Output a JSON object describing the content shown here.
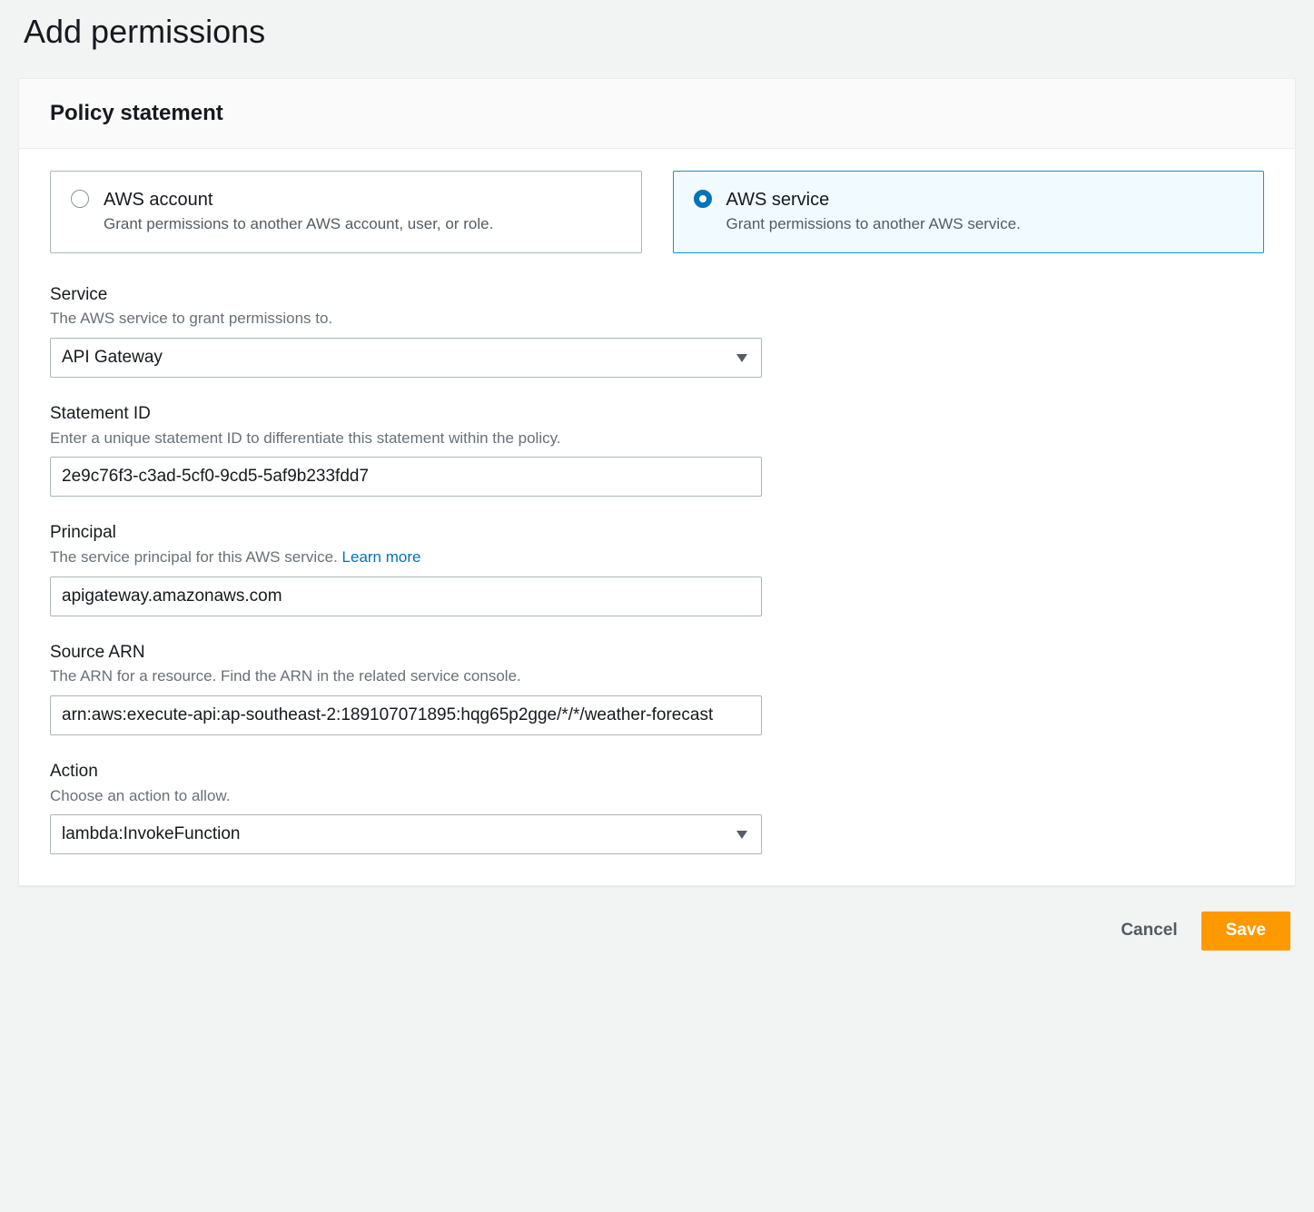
{
  "page": {
    "title": "Add permissions"
  },
  "panel": {
    "header": "Policy statement"
  },
  "radio": {
    "account": {
      "title": "AWS account",
      "desc": "Grant permissions to another AWS account, user, or role."
    },
    "service": {
      "title": "AWS service",
      "desc": "Grant permissions to another AWS service."
    }
  },
  "fields": {
    "service": {
      "label": "Service",
      "hint": "The AWS service to grant permissions to.",
      "value": "API Gateway"
    },
    "statement_id": {
      "label": "Statement ID",
      "hint": "Enter a unique statement ID to differentiate this statement within the policy.",
      "value": "2e9c76f3-c3ad-5cf0-9cd5-5af9b233fdd7"
    },
    "principal": {
      "label": "Principal",
      "hint_prefix": "The service principal for this AWS service. ",
      "learn_more": "Learn more",
      "value": "apigateway.amazonaws.com"
    },
    "source_arn": {
      "label": "Source ARN",
      "hint": "The ARN for a resource. Find the ARN in the related service console.",
      "value": "arn:aws:execute-api:ap-southeast-2:189107071895:hqg65p2gge/*/*/weather-forecast"
    },
    "action": {
      "label": "Action",
      "hint": "Choose an action to allow.",
      "value": "lambda:InvokeFunction"
    }
  },
  "buttons": {
    "cancel": "Cancel",
    "save": "Save"
  }
}
